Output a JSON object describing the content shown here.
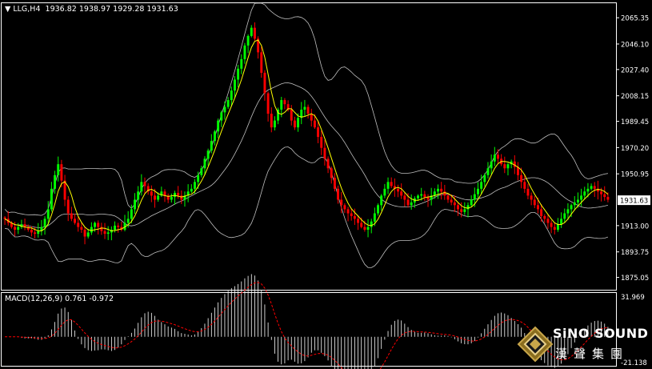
{
  "header": {
    "symbol": "LLG,H4",
    "ohlc": "1936.82 1938.97 1929.28 1931.63",
    "menu_icon": "triangle-down-icon"
  },
  "macd_label": "MACD(12,26,9) 0.761 -0.972",
  "logo": {
    "brand": "SiNO SOUND",
    "chinese": "漢聲集團"
  },
  "chart_data": [
    {
      "type": "candlestick",
      "name": "LLG,H4",
      "ylim": [
        1866,
        2076
      ],
      "yticks": [
        "2065.35",
        "2046.10",
        "2027.40",
        "2008.15",
        "1989.45",
        "1970.20",
        "1950.95",
        "1913.00",
        "1893.75",
        "1875.05"
      ],
      "current_price": "1931.63",
      "current_value": 1931.63,
      "colors": {
        "up": "#00ff00",
        "down": "#ff0000",
        "ma": "#ffff00",
        "bands": "#bfbfbf",
        "background": "#000000",
        "price_tag_bg": "#ffffff"
      },
      "indicators": [
        "moving average (yellow)",
        "Bollinger bands (grey)"
      ],
      "close": [
        1918,
        1915,
        1912,
        1910,
        1912,
        1914,
        1912,
        1910,
        1908,
        1907,
        1909,
        1912,
        1918,
        1925,
        1940,
        1950,
        1958,
        1946,
        1932,
        1922,
        1918,
        1915,
        1912,
        1910,
        1905,
        1908,
        1912,
        1915,
        1912,
        1909,
        1907,
        1908,
        1910,
        1913,
        1912,
        1910,
        1915,
        1918,
        1925,
        1932,
        1938,
        1945,
        1942,
        1938,
        1935,
        1932,
        1935,
        1938,
        1935,
        1932,
        1934,
        1937,
        1935,
        1932,
        1935,
        1938,
        1940,
        1945,
        1950,
        1955,
        1962,
        1968,
        1975,
        1982,
        1990,
        1996,
        2000,
        2005,
        2012,
        2020,
        2028,
        2035,
        2045,
        2052,
        2058,
        2050,
        2040,
        2025,
        2010,
        1995,
        1985,
        1990,
        1998,
        2005,
        2002,
        1998,
        1990,
        1985,
        1992,
        1998,
        2000,
        1995,
        1990,
        1985,
        1978,
        1970,
        1962,
        1955,
        1948,
        1940,
        1932,
        1928,
        1925,
        1922,
        1920,
        1918,
        1915,
        1912,
        1910,
        1912,
        1916,
        1922,
        1928,
        1935,
        1940,
        1945,
        1942,
        1940,
        1938,
        1935,
        1932,
        1928,
        1930,
        1933,
        1935,
        1936,
        1934,
        1932,
        1935,
        1938,
        1940,
        1938,
        1935,
        1932,
        1930,
        1928,
        1925,
        1923,
        1925,
        1928,
        1932,
        1936,
        1940,
        1945,
        1950,
        1955,
        1960,
        1965,
        1962,
        1958,
        1955,
        1958,
        1960,
        1956,
        1950,
        1945,
        1940,
        1935,
        1932,
        1928,
        1925,
        1920,
        1918,
        1915,
        1912,
        1910,
        1914,
        1918,
        1922,
        1925,
        1928,
        1930,
        1932,
        1935,
        1938,
        1940,
        1942,
        1940,
        1938,
        1936,
        1934,
        1932
      ]
    },
    {
      "type": "histogram",
      "name": "MACD(12,26,9)",
      "macd": 0.761,
      "signal": -0.972,
      "ylim": [
        -21.138,
        31.969
      ],
      "yticks": [
        "31.969",
        "-21.138"
      ],
      "colors": {
        "histogram": "#ffffff",
        "signal": "#ff0000"
      }
    }
  ]
}
